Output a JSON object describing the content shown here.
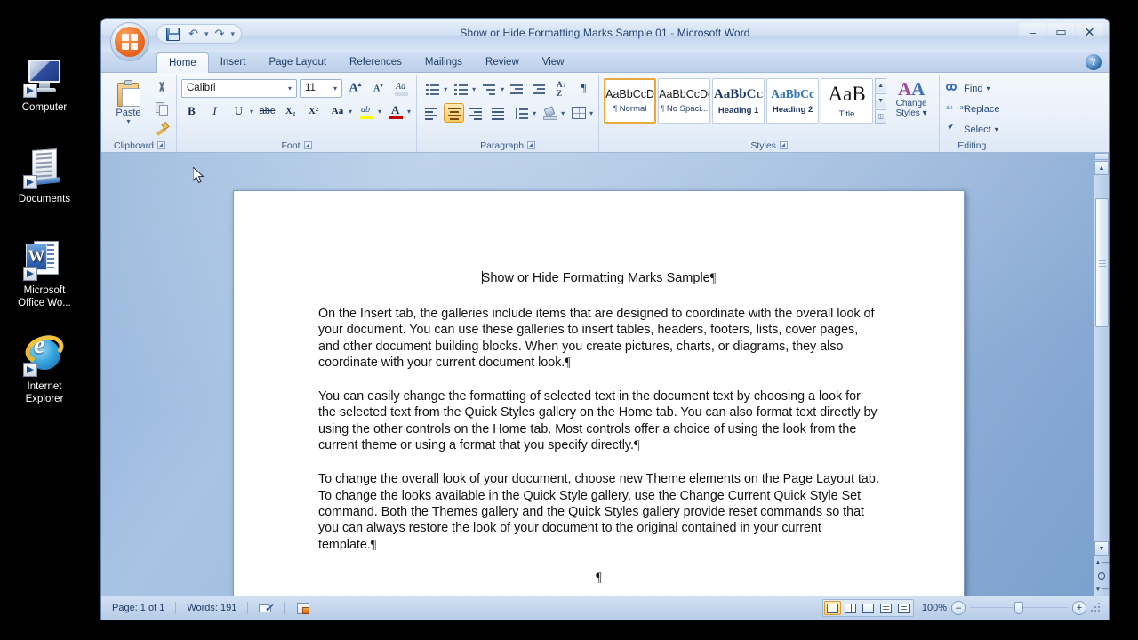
{
  "desktop": {
    "icons": [
      {
        "label": "Computer",
        "icon": "computer-icon"
      },
      {
        "label": "Documents",
        "icon": "documents-icon"
      },
      {
        "label": "Microsoft\nOffice Wo...",
        "label_line1": "Microsoft",
        "label_line2": "Office Wo...",
        "icon": "word-icon"
      },
      {
        "label": "Internet\nExplorer",
        "label_line1": "Internet",
        "label_line2": "Explorer",
        "icon": "internet-explorer-icon"
      }
    ]
  },
  "window": {
    "title_document": "Show or Hide Formatting Marks Sample 01",
    "title_separator": "-",
    "title_app": "Microsoft Word",
    "office_button": "Office Button",
    "quick_access": [
      {
        "name": "save",
        "label": "Save"
      },
      {
        "name": "undo",
        "label": "Undo"
      },
      {
        "name": "redo",
        "label": "Redo"
      },
      {
        "name": "customize",
        "label": "Customize Quick Access Toolbar"
      }
    ],
    "controls": {
      "minimize": "–",
      "maximize": "▭",
      "close": "✕"
    },
    "help": "?"
  },
  "ribbon": {
    "tabs": [
      {
        "label": "Home",
        "active": true
      },
      {
        "label": "Insert",
        "active": false
      },
      {
        "label": "Page Layout",
        "active": false
      },
      {
        "label": "References",
        "active": false
      },
      {
        "label": "Mailings",
        "active": false
      },
      {
        "label": "Review",
        "active": false
      },
      {
        "label": "View",
        "active": false
      }
    ],
    "groups": {
      "clipboard": {
        "label": "Clipboard",
        "paste": "Paste",
        "cut": "Cut",
        "copy": "Copy",
        "format_painter": "Format Painter"
      },
      "font": {
        "label": "Font",
        "font_name": "Calibri",
        "font_size": "11",
        "grow_font": "Grow Font",
        "shrink_font": "Shrink Font",
        "clear_formatting": "Clear Formatting",
        "bold": "B",
        "italic": "I",
        "underline": "U",
        "strikethrough": "abc",
        "subscript": "X₂",
        "superscript": "X²",
        "change_case": "Aa",
        "text_highlight": "Text Highlight Color",
        "font_color": "Font Color"
      },
      "paragraph": {
        "label": "Paragraph",
        "bullets": "Bullets",
        "numbering": "Numbering",
        "multilevel_list": "Multilevel List",
        "decrease_indent": "Decrease Indent",
        "increase_indent": "Increase Indent",
        "sort": "Sort",
        "show_hide_marks": "¶",
        "align_left": "Align Text Left",
        "align_center": "Center",
        "align_right": "Align Text Right",
        "justify": "Justify",
        "line_spacing": "Line Spacing",
        "shading": "Shading",
        "borders": "Borders",
        "active_alignment": "align_center"
      },
      "styles": {
        "label": "Styles",
        "cards": [
          {
            "sample": "AaBbCcDc",
            "name": "Normal",
            "pilcrow": "¶",
            "selected": true
          },
          {
            "sample": "AaBbCcDc",
            "name": "No Spaci...",
            "pilcrow": "¶",
            "selected": false
          },
          {
            "sample": "AaBbCᴄ",
            "name": "Heading 1",
            "pilcrow": "",
            "selected": false
          },
          {
            "sample": "AaBbCc",
            "name": "Heading 2",
            "pilcrow": "",
            "selected": false
          },
          {
            "sample": "AaB",
            "name": "Title",
            "pilcrow": "",
            "selected": false
          }
        ],
        "change_styles_line1": "Change",
        "change_styles_line2": "Styles"
      },
      "editing": {
        "label": "Editing",
        "find": "Find",
        "replace": "Replace",
        "select": "Select"
      }
    }
  },
  "document": {
    "title_line": "Show or Hide Formatting Marks Sample",
    "paragraphs": [
      "On the Insert tab, the galleries include items that are designed to coordinate with the overall look of your document. You can use these galleries to insert tables, headers, footers, lists, cover pages, and other document building blocks. When you create pictures, charts, or diagrams, they also coordinate with your current document look.",
      "You can easily change the formatting of selected text in the document text by choosing a look for the selected text from the Quick Styles gallery on the Home tab. You can also format text directly by using the other controls on the Home tab. Most controls offer a choice of using the look from the current theme or using a format that you specify directly.",
      "To change the overall look of your document, choose new Theme elements on the Page Layout tab. To change the looks available in the Quick Style gallery, use the Change Current Quick Style Set command. Both the Themes gallery and the Quick Styles gallery provide reset commands so that you can always restore the look of your document to the original contained in your current template."
    ],
    "pilcrow": "¶"
  },
  "statusbar": {
    "page": "Page: 1 of 1",
    "words": "Words: 191",
    "proofing": "Proofing errors",
    "language": "Language",
    "views": [
      {
        "name": "print-layout",
        "selected": true
      },
      {
        "name": "full-screen-reading",
        "selected": false
      },
      {
        "name": "web-layout",
        "selected": false
      },
      {
        "name": "outline",
        "selected": false
      },
      {
        "name": "draft",
        "selected": false
      }
    ],
    "zoom_level": "100%",
    "zoom_out": "–",
    "zoom_in": "+"
  },
  "colors": {
    "accent_orange": "#e8a93a",
    "title_text": "#24426e",
    "ribbon_bg": "#eaf1fa",
    "doc_bg": "#9bb8dd",
    "page_white": "#ffffff"
  }
}
